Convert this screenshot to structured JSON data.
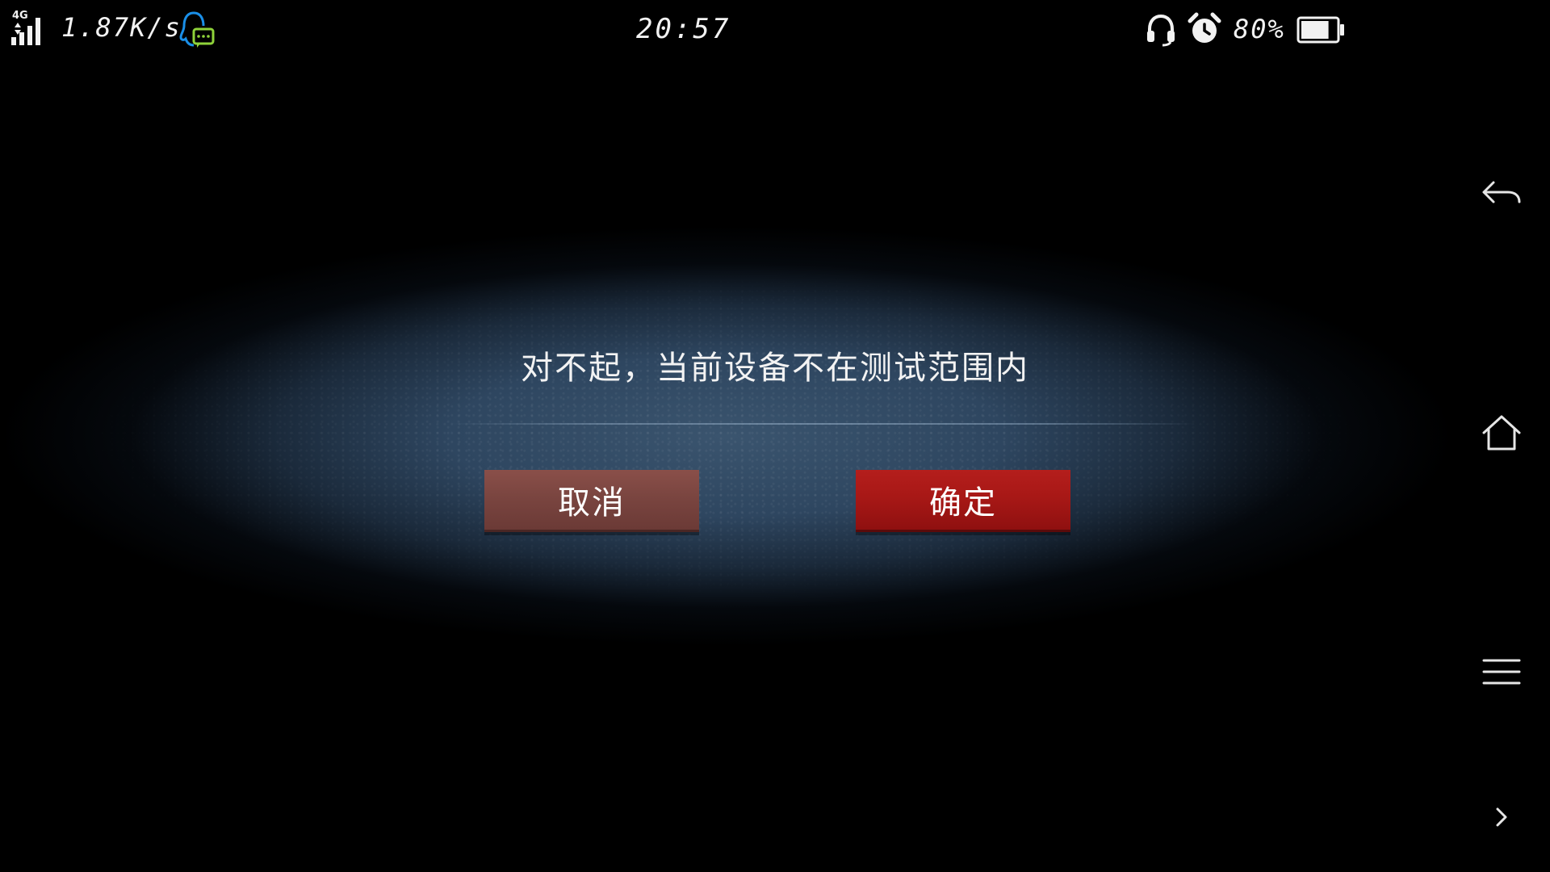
{
  "status_bar": {
    "network_type": "4G",
    "speed": "1.87K/s",
    "time": "20:57",
    "battery_percent": "80%",
    "battery_level": 0.8
  },
  "dialog": {
    "message": "对不起，当前设备不在测试范围内",
    "cancel_label": "取消",
    "confirm_label": "确定"
  },
  "nav_bar": {
    "icons": [
      "back-icon",
      "home-icon",
      "menu-icon",
      "chevron-right-icon"
    ]
  },
  "colors": {
    "background": "#000000",
    "dialog_blue": "#2e4660",
    "cancel_button": "#7a4540",
    "confirm_button": "#a81816",
    "qq_icon_blue": "#1a8fe8",
    "qq_icon_green": "#8fd33a"
  }
}
